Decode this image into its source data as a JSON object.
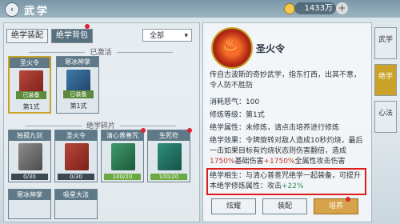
{
  "header": {
    "title": "武学",
    "back_icon": "back-arrow-icon",
    "currency": "1433万",
    "plus": "+"
  },
  "left": {
    "tabs": [
      {
        "label": "绝学装配"
      },
      {
        "label": "绝学背包"
      }
    ],
    "filter": "全部",
    "sections": {
      "activated": "已激活",
      "fragments": "绝学碎片"
    },
    "activated_cards": [
      {
        "name": "圣火令",
        "badge": "已装备",
        "tier": "第1式"
      },
      {
        "name": "寒冰神掌",
        "badge": "已装备",
        "tier": "第1式"
      }
    ],
    "fragment_cards": [
      {
        "name": "独孤九剑",
        "progress": "0/30",
        "fraction": 0.0
      },
      {
        "name": "圣火令",
        "progress": "0/30",
        "fraction": 0.0
      },
      {
        "name": "清心普善咒",
        "progress": "100/20",
        "fraction": 1.0
      },
      {
        "name": "生死符",
        "progress": "100/20",
        "fraction": 1.0
      },
      {
        "name": "寒冰神掌",
        "progress": "",
        "fraction": 0.0
      },
      {
        "name": "吸星大法",
        "progress": "",
        "fraction": 0.0
      }
    ]
  },
  "detail": {
    "name": "圣火令",
    "description": "传自古波斯的奇妙武学，指东打西，出其不意，令人防不胜防",
    "cost_label": "消耗怒气：",
    "cost_value": "100",
    "level_label": "修炼等级：",
    "level_value": "第1式",
    "attr_label": "绝学属性：",
    "attr_value": "未修炼，请点击培养进行修炼",
    "effect_label": "绝学效果：",
    "effect_text": "令牌旋转对敌人造成10秒灼烧，最后一击如果目标有灼烧状态则伤害翻倍，造成",
    "effect_hl1": "1750%",
    "effect_mid": "基础伤害",
    "effect_hl2": "+1750%",
    "effect_tail": "全属性攻击伤害",
    "synergy_label": "绝学相生：",
    "synergy_text": "与清心普善咒绝学一起装备，可提升本绝学修炼属性：攻击",
    "synergy_bonus": "+22%",
    "buttons": [
      "炫耀",
      "装配",
      "培养"
    ]
  },
  "side_tabs": [
    "武学",
    "绝学",
    "心法"
  ]
}
